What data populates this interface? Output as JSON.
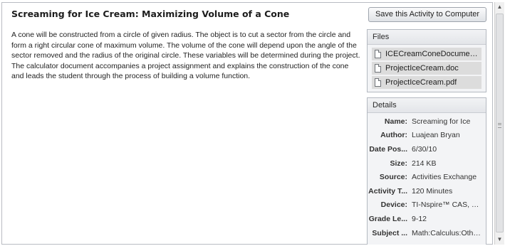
{
  "activity": {
    "title": "Screaming for Ice Cream: Maximizing Volume of a Cone",
    "description": "A cone will be constructed from a circle of given radius. The object is to cut a sector from the circle and form a right circular cone of maximum volume. The volume of the cone will depend upon the angle of the sector removed and the radius of the original circle. These variables will be determined during the project. The calculator document accompanies a project assignment and explains the construction of the cone and leads the student through the process of building a volume function."
  },
  "toolbar": {
    "save_label": "Save this Activity to Computer"
  },
  "files": {
    "header": "Files",
    "items": [
      {
        "name": "ICECreamConeDocument.t..."
      },
      {
        "name": "ProjectIceCream.doc"
      },
      {
        "name": "ProjectIceCream.pdf"
      }
    ]
  },
  "details": {
    "header": "Details",
    "rows": [
      {
        "label": "Name:",
        "value": "Screaming for Ice"
      },
      {
        "label": "Author:",
        "value": "Luajean Bryan"
      },
      {
        "label": "Date Pos...",
        "value": "6/30/10"
      },
      {
        "label": "Size:",
        "value": "214 KB"
      },
      {
        "label": "Source:",
        "value": "Activities Exchange"
      },
      {
        "label": "Activity T...",
        "value": "120 Minutes"
      },
      {
        "label": "Device:",
        "value": "TI-Nspire™ CAS, TI-..."
      },
      {
        "label": "Grade Le...",
        "value": "9-12"
      },
      {
        "label": "Subject ...",
        "value": "Math:Calculus:Other..."
      }
    ]
  },
  "scrollbar": {
    "up_icon": "triangle-up",
    "down_icon": "triangle-down"
  }
}
